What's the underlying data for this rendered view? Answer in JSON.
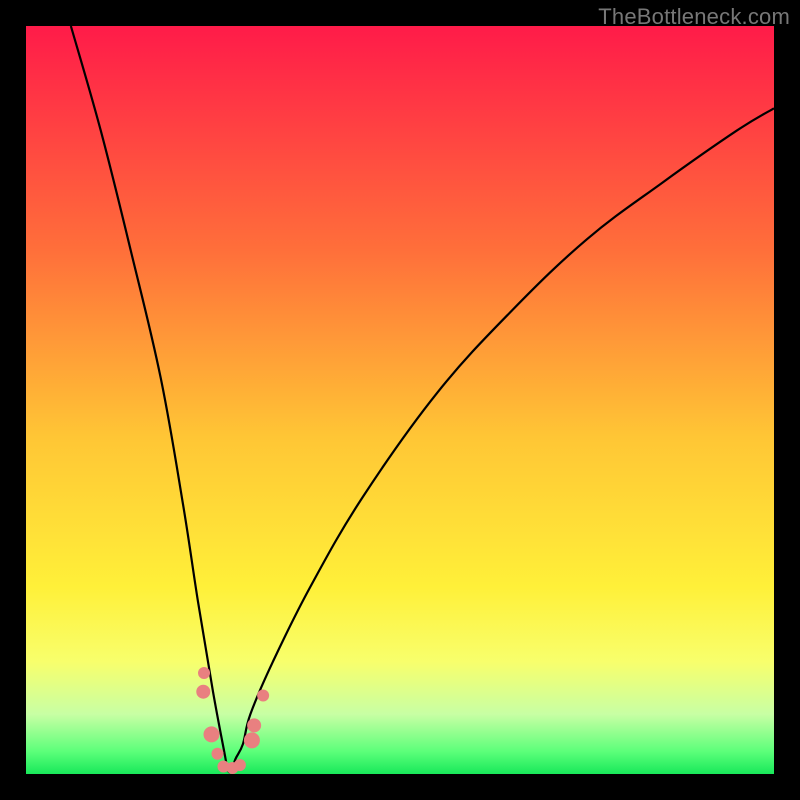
{
  "watermark": "TheBottleneck.com",
  "colors": {
    "background": "#000000",
    "gradient_top": "#ff1b49",
    "gradient_bottom": "#18e85a",
    "curve": "#000000",
    "dots": "#e98080"
  },
  "chart_data": {
    "type": "line",
    "title": "",
    "xlabel": "",
    "ylabel": "",
    "xlim": [
      0,
      100
    ],
    "ylim": [
      0,
      100
    ],
    "notes": "V-shaped bottleneck curve with sharp minimum near x≈27; color gradient encodes value (red=high bottleneck, green=low). No axis ticks or numeric labels are visible; curve shape is estimated from pixel geometry.",
    "series": [
      {
        "name": "bottleneck-curve",
        "x": [
          6,
          10,
          14,
          18,
          21,
          23,
          25,
          26.5,
          27,
          27.5,
          28,
          29,
          30,
          33,
          38,
          45,
          55,
          65,
          75,
          85,
          95,
          100
        ],
        "values": [
          100,
          86,
          70,
          53,
          36,
          23,
          11,
          3,
          0.5,
          0.5,
          2,
          4,
          8,
          15,
          25,
          37,
          51,
          62,
          71.5,
          79,
          86,
          89
        ]
      }
    ],
    "markers": [
      {
        "x": 23.8,
        "y": 13.5,
        "r": 6
      },
      {
        "x": 23.7,
        "y": 11.0,
        "r": 7
      },
      {
        "x": 24.8,
        "y": 5.3,
        "r": 8
      },
      {
        "x": 25.6,
        "y": 2.7,
        "r": 6
      },
      {
        "x": 26.4,
        "y": 1.0,
        "r": 6
      },
      {
        "x": 27.6,
        "y": 0.8,
        "r": 6
      },
      {
        "x": 28.6,
        "y": 1.2,
        "r": 6
      },
      {
        "x": 30.2,
        "y": 4.5,
        "r": 8
      },
      {
        "x": 30.5,
        "y": 6.5,
        "r": 7
      },
      {
        "x": 31.7,
        "y": 10.5,
        "r": 6
      }
    ]
  }
}
